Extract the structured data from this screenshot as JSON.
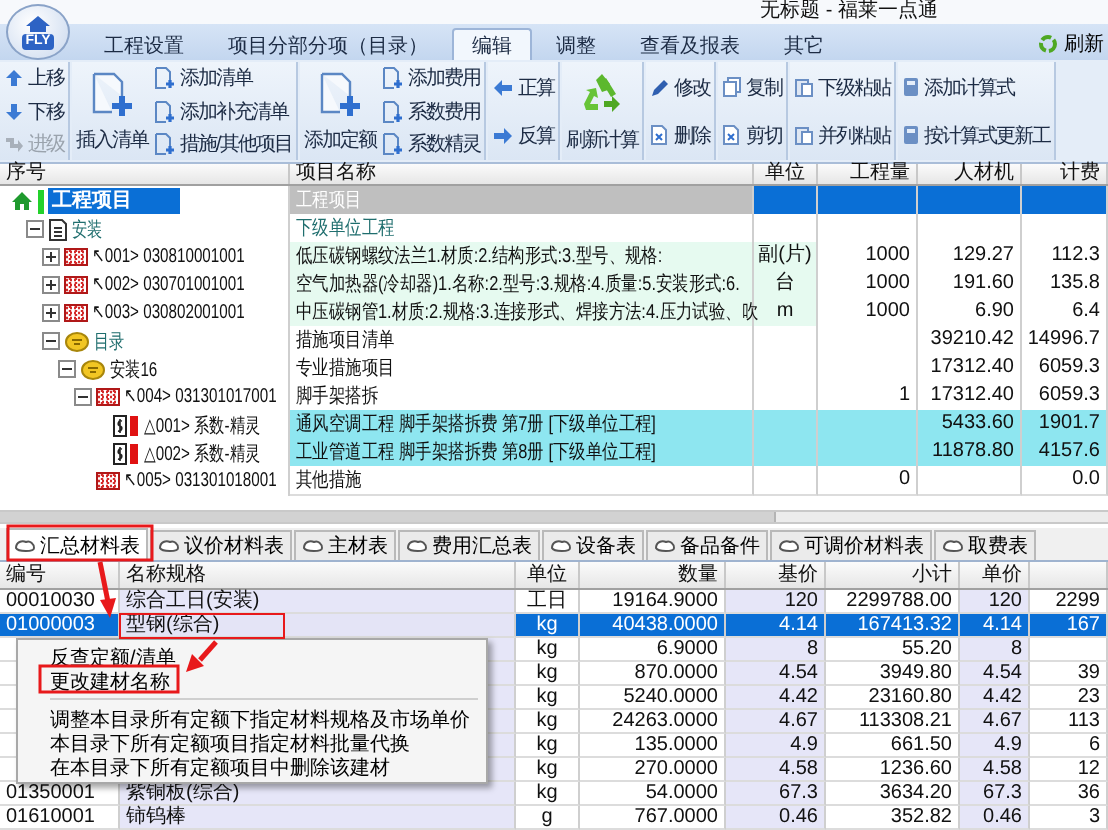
{
  "window": {
    "title": "无标题 - 福莱一点通",
    "logo": "FLY"
  },
  "menu": [
    {
      "label": "工程设置",
      "selected": false
    },
    {
      "label": "项目分部分项（目录）",
      "selected": false
    },
    {
      "label": "编辑",
      "selected": true
    },
    {
      "label": "调整",
      "selected": false
    },
    {
      "label": "查看及报表",
      "selected": false
    },
    {
      "label": "其它",
      "selected": false
    }
  ],
  "menu_right": {
    "label": "刷新"
  },
  "ribbon": [
    {
      "items": [
        {
          "label": "上移",
          "kind": "up",
          "disabled": false
        },
        {
          "label": "下移",
          "kind": "down",
          "disabled": false
        },
        {
          "label": "进级",
          "kind": "promote",
          "disabled": true
        }
      ]
    },
    {
      "big": {
        "label": "插入清单",
        "kind": "insert"
      },
      "items": [
        {
          "label": "添加清单",
          "kind": "add",
          "disabled": false
        },
        {
          "label": "添加补充清单",
          "kind": "add",
          "disabled": false
        },
        {
          "label": "措施/其他项目",
          "kind": "add",
          "disabled": false
        }
      ]
    },
    {
      "big": {
        "label": "添加定额",
        "kind": "insert"
      },
      "items": [
        {
          "label": "添加费用",
          "kind": "add",
          "disabled": false
        },
        {
          "label": "系数费用",
          "kind": "add",
          "disabled": false
        },
        {
          "label": "系数精灵",
          "kind": "add",
          "disabled": false
        }
      ]
    },
    {
      "items": [
        {
          "label": "正算",
          "kind": "left",
          "disabled": false
        },
        {
          "label": "反算",
          "kind": "right",
          "disabled": false
        }
      ]
    },
    {
      "big": {
        "label": "刷新计算",
        "kind": "refresh"
      }
    },
    {
      "items": [
        {
          "label": "修改",
          "kind": "edit",
          "disabled": false
        },
        {
          "label": "删除",
          "kind": "delete",
          "disabled": false
        }
      ]
    },
    {
      "items": [
        {
          "label": "复制",
          "kind": "copy",
          "disabled": false
        },
        {
          "label": "剪切",
          "kind": "cut",
          "disabled": false
        }
      ]
    },
    {
      "items": [
        {
          "label": "下级粘贴",
          "kind": "paste",
          "disabled": false
        },
        {
          "label": "并列粘贴",
          "kind": "paste",
          "disabled": false
        }
      ]
    },
    {
      "items": [
        {
          "label": "添加计算式",
          "kind": "calc",
          "disabled": false
        },
        {
          "label": "按计算式更新工",
          "kind": "calc",
          "disabled": false
        }
      ]
    }
  ],
  "tree": {
    "columns": [
      "序号",
      "项目名称",
      "单位",
      "工程量",
      "人材机",
      "计费"
    ],
    "rows": [
      {
        "kind": "home",
        "code": "工程项目",
        "name": "工程项目",
        "selected": true,
        "children": [
          {
            "kind": "unit",
            "code": "安装",
            "name": "下级单位工程",
            "selected": false,
            "expanded": true,
            "children": [
              {
                "kind": "item",
                "code": "↖001> 030810001001",
                "name": "低压碳钢螺纹法兰1.材质:2.结构形式:3.型号、规格:",
                "unit": "副(片)",
                "quantity": "1000",
                "cost": "129.27",
                "fee": "112.3",
                "selected": false,
                "expanded": false
              },
              {
                "kind": "item",
                "code": "↖002> 030701001001",
                "name": "空气加热器(冷却器)1.名称:2.型号:3.规格:4.质量:5.安装形式:6.",
                "unit": "台",
                "quantity": "1000",
                "cost": "191.60",
                "fee": "135.8",
                "selected": false,
                "expanded": false
              },
              {
                "kind": "item",
                "code": "↖003> 030802001001",
                "name": "中压碳钢管1.材质:2.规格:3.连接形式、焊接方法:4.压力试验、吹",
                "unit": "m",
                "quantity": "1000",
                "cost": "6.90",
                "fee": "6.4",
                "selected": false,
                "expanded": false
              },
              {
                "kind": "folder",
                "code": "目录",
                "name": "措施项目清单",
                "cost": "39210.42",
                "fee": "14996.7",
                "selected": false,
                "expanded": true,
                "children": [
                  {
                    "kind": "folder",
                    "code": "安装16",
                    "name": "专业措施项目",
                    "cost": "17312.40",
                    "fee": "6059.3",
                    "selected": false,
                    "expanded": true,
                    "children": [
                      {
                        "kind": "measure",
                        "code": "↖004> 031301017001",
                        "name": "脚手架搭拆",
                        "quantity": "1",
                        "cost": "17312.40",
                        "fee": "6059.3",
                        "selected": false,
                        "expanded": true,
                        "children": [
                          {
                            "kind": "coef",
                            "code": "△001> 系数-精灵",
                            "name": "通风空调工程 脚手架搭拆费 第7册 [下级单位工程]",
                            "cost": "5433.60",
                            "fee": "1901.7",
                            "selected": false
                          },
                          {
                            "kind": "coef",
                            "code": "△002> 系数-精灵",
                            "name": "工业管道工程 脚手架搭拆费 第8册 [下级单位工程]",
                            "cost": "11878.80",
                            "fee": "4157.6",
                            "selected": false
                          }
                        ]
                      },
                      {
                        "kind": "measure",
                        "code": "↖005> 031301018001",
                        "name": "其他措施",
                        "quantity": "0",
                        "fee": "0.0",
                        "selected": false
                      }
                    ]
                  }
                ]
              }
            ]
          }
        ]
      }
    ]
  },
  "bottom_tabs": [
    {
      "label": "汇总材料表",
      "selected": true
    },
    {
      "label": "议价材料表",
      "selected": false
    },
    {
      "label": "主材表",
      "selected": false
    },
    {
      "label": "费用汇总表",
      "selected": false
    },
    {
      "label": "设备表",
      "selected": false
    },
    {
      "label": "备品备件",
      "selected": false
    },
    {
      "label": "可调价材料表",
      "selected": false
    },
    {
      "label": "取费表",
      "selected": false
    }
  ],
  "materials": {
    "columns": [
      "编号",
      "名称规格",
      "单位",
      "数量",
      "基价",
      "小计",
      "单价"
    ],
    "rows": [
      {
        "code": "00010030",
        "name": "综合工日(安装)",
        "unit": "工日",
        "quantity": "19164.9000",
        "base_price": "120",
        "subtotal": "2299788.00",
        "unit_price": "120",
        "column_8": "2299",
        "selected": false
      },
      {
        "code": "01000003",
        "name": "型钢(综合)",
        "unit": "kg",
        "quantity": "40438.0000",
        "base_price": "4.14",
        "subtotal": "167413.32",
        "unit_price": "4.14",
        "column_8": "167",
        "selected": true
      },
      {
        "unit": "kg",
        "quantity": "6.9000",
        "base_price": "8",
        "subtotal": "55.20",
        "unit_price": "8",
        "selected": false
      },
      {
        "unit": "kg",
        "quantity": "870.0000",
        "base_price": "4.54",
        "subtotal": "3949.80",
        "unit_price": "4.54",
        "column_8": "39",
        "selected": false
      },
      {
        "unit": "kg",
        "quantity": "5240.0000",
        "base_price": "4.42",
        "subtotal": "23160.80",
        "unit_price": "4.42",
        "column_8": "23",
        "selected": false
      },
      {
        "unit": "kg",
        "quantity": "24263.0000",
        "base_price": "4.67",
        "subtotal": "113308.21",
        "unit_price": "4.67",
        "column_8": "113",
        "selected": false
      },
      {
        "unit": "kg",
        "quantity": "135.0000",
        "base_price": "4.9",
        "subtotal": "661.50",
        "unit_price": "4.9",
        "column_8": "6",
        "selected": false
      },
      {
        "unit": "kg",
        "quantity": "270.0000",
        "base_price": "4.58",
        "subtotal": "1236.60",
        "unit_price": "4.58",
        "column_8": "12",
        "selected": false
      },
      {
        "code": "01350001",
        "name": "紫铜板(综合)",
        "unit": "kg",
        "quantity": "54.0000",
        "base_price": "67.3",
        "subtotal": "3634.20",
        "unit_price": "67.3",
        "column_8": "36",
        "selected": false
      },
      {
        "code": "01610001",
        "name": "铈钨棒",
        "unit": "g",
        "quantity": "767.0000",
        "base_price": "0.46",
        "subtotal": "352.82",
        "unit_price": "0.46",
        "column_8": "3",
        "selected": false
      }
    ]
  },
  "context_menu": [
    {
      "kind": "item",
      "label": "反查定额/清单"
    },
    {
      "kind": "item",
      "label": "更改建材名称"
    },
    {
      "kind": "separator"
    },
    {
      "kind": "item",
      "label": "调整本目录所有定额下指定材料规格及市场单价"
    },
    {
      "kind": "item",
      "label": "本目录下所有定额项目指定材料批量代换"
    },
    {
      "kind": "item",
      "label": "在本目录下所有定额项目中删除该建材"
    }
  ]
}
